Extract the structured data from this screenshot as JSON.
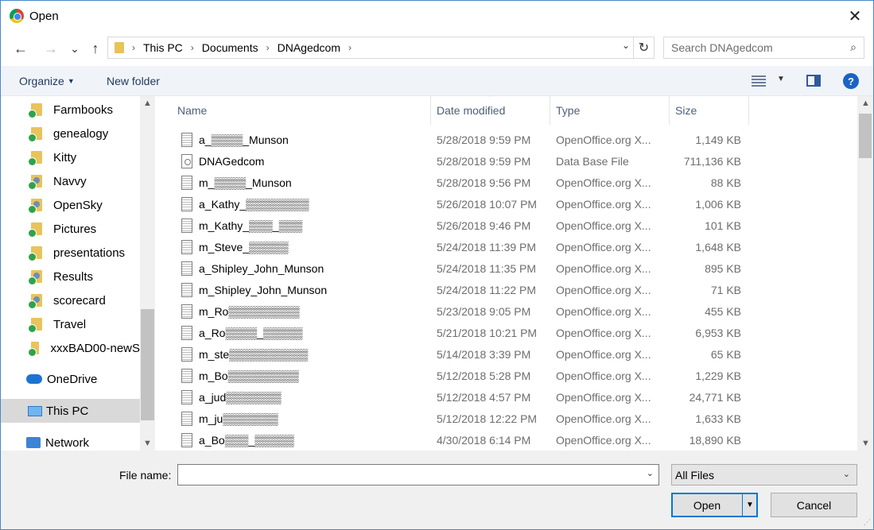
{
  "window": {
    "title": "Open",
    "close_glyph": "✕"
  },
  "nav": {
    "back": "←",
    "forward": "→",
    "recent": "⌄",
    "up": "↑"
  },
  "address": {
    "crumbs": [
      "This PC",
      "Documents",
      "DNAgedcom"
    ],
    "separator": "›",
    "dropdown": "⌄",
    "refresh": "↻"
  },
  "search": {
    "placeholder": "Search DNAgedcom",
    "value": "",
    "icon": "⌕"
  },
  "commands": {
    "organize": "Organize",
    "organize_caret": "▼",
    "new_folder": "New folder",
    "view_caret": "▼",
    "help": "?"
  },
  "sidebar": {
    "items": [
      {
        "label": "Farmbooks",
        "icon": "folder"
      },
      {
        "label": "genealogy",
        "icon": "folder"
      },
      {
        "label": "Kitty",
        "icon": "folder"
      },
      {
        "label": "Navvy",
        "icon": "folder-person"
      },
      {
        "label": "OpenSky",
        "icon": "folder-person"
      },
      {
        "label": "Pictures",
        "icon": "folder"
      },
      {
        "label": "presentations",
        "icon": "folder"
      },
      {
        "label": "Results",
        "icon": "folder-person"
      },
      {
        "label": "scorecard",
        "icon": "folder-person"
      },
      {
        "label": "Travel",
        "icon": "folder"
      },
      {
        "label": "xxxBAD00-newS",
        "icon": "folder"
      }
    ],
    "onedrive": "OneDrive",
    "this_pc": "This PC",
    "network": "Network",
    "scroll_up": "▲",
    "scroll_down": "▼"
  },
  "columns": {
    "name": "Name",
    "date": "Date modified",
    "type": "Type",
    "size": "Size",
    "sort_caret": "⌃"
  },
  "files": [
    {
      "name": "a_▒▒▒▒_Munson",
      "date": "5/28/2018 9:59 PM",
      "type": "OpenOffice.org X...",
      "size": "1,149 KB",
      "icon": "sheet"
    },
    {
      "name": "DNAGedcom",
      "date": "5/28/2018 9:59 PM",
      "type": "Data Base File",
      "size": "711,136 KB",
      "icon": "db"
    },
    {
      "name": "m_▒▒▒▒_Munson",
      "date": "5/28/2018 9:56 PM",
      "type": "OpenOffice.org X...",
      "size": "88 KB",
      "icon": "sheet"
    },
    {
      "name": "a_Kathy_▒▒▒▒▒▒▒▒",
      "date": "5/26/2018 10:07 PM",
      "type": "OpenOffice.org X...",
      "size": "1,006 KB",
      "icon": "sheet"
    },
    {
      "name": "m_Kathy_▒▒▒_▒▒▒",
      "date": "5/26/2018 9:46 PM",
      "type": "OpenOffice.org X...",
      "size": "101 KB",
      "icon": "sheet"
    },
    {
      "name": "m_Steve_▒▒▒▒▒",
      "date": "5/24/2018 11:39 PM",
      "type": "OpenOffice.org X...",
      "size": "1,648 KB",
      "icon": "sheet"
    },
    {
      "name": "a_Shipley_John_Munson",
      "date": "5/24/2018 11:35 PM",
      "type": "OpenOffice.org X...",
      "size": "895 KB",
      "icon": "sheet"
    },
    {
      "name": "m_Shipley_John_Munson",
      "date": "5/24/2018 11:22 PM",
      "type": "OpenOffice.org X...",
      "size": "71 KB",
      "icon": "sheet"
    },
    {
      "name": "m_Ro▒▒▒▒▒▒▒▒▒",
      "date": "5/23/2018 9:05 PM",
      "type": "OpenOffice.org X...",
      "size": "455 KB",
      "icon": "sheet"
    },
    {
      "name": "a_Ro▒▒▒▒_▒▒▒▒▒",
      "date": "5/21/2018 10:21 PM",
      "type": "OpenOffice.org X...",
      "size": "6,953 KB",
      "icon": "sheet"
    },
    {
      "name": "m_ste▒▒▒▒▒▒▒▒▒▒",
      "date": "5/14/2018 3:39 PM",
      "type": "OpenOffice.org X...",
      "size": "65 KB",
      "icon": "sheet"
    },
    {
      "name": "m_Bo▒▒▒▒▒▒▒▒▒",
      "date": "5/12/2018 5:28 PM",
      "type": "OpenOffice.org X...",
      "size": "1,229 KB",
      "icon": "sheet"
    },
    {
      "name": "a_jud▒▒▒▒▒▒▒",
      "date": "5/12/2018 4:57 PM",
      "type": "OpenOffice.org X...",
      "size": "24,771 KB",
      "icon": "sheet"
    },
    {
      "name": "m_ju▒▒▒▒▒▒▒",
      "date": "5/12/2018 12:22 PM",
      "type": "OpenOffice.org X...",
      "size": "1,633 KB",
      "icon": "sheet"
    },
    {
      "name": "a_Bo▒▒▒_▒▒▒▒▒",
      "date": "4/30/2018 6:14 PM",
      "type": "OpenOffice.org X...",
      "size": "18,890 KB",
      "icon": "sheet"
    }
  ],
  "filelist_scroll": {
    "up": "▲",
    "down": "▼"
  },
  "bottom": {
    "filename_label": "File name:",
    "filename_value": "",
    "filename_drop": "⌄",
    "filter_value": "All Files",
    "filter_caret": "⌄",
    "open_label": "Open",
    "open_split": "▼",
    "cancel_label": "Cancel"
  }
}
